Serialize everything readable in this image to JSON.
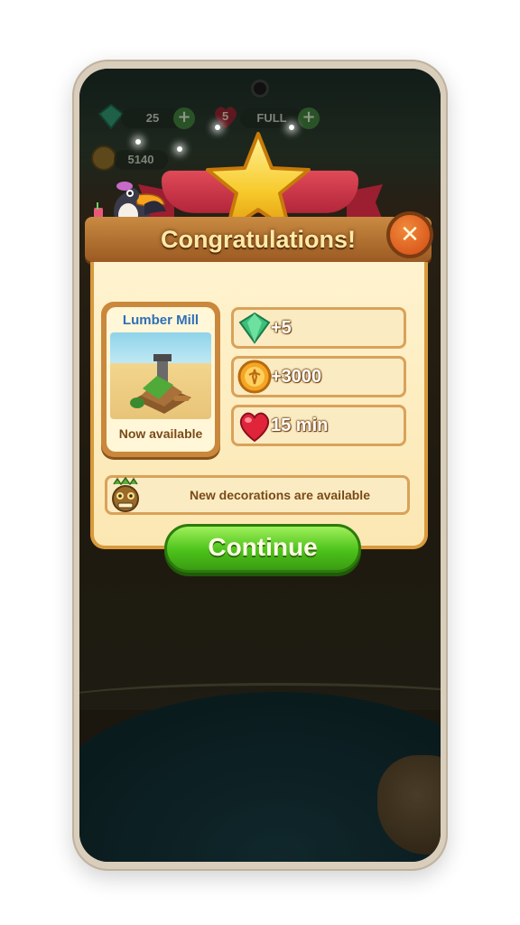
{
  "hud": {
    "gems": "25",
    "lives": "5",
    "lives_status": "FULL",
    "coins": "5140"
  },
  "dialog": {
    "title": "Congratulations!",
    "close_icon": "close-x-icon",
    "unlock_card": {
      "title": "Lumber Mill",
      "footer": "Now available"
    },
    "rewards": [
      {
        "icon": "gem-icon",
        "value": "+5"
      },
      {
        "icon": "coin-icon",
        "value": "+3000"
      },
      {
        "icon": "heart-icon",
        "value": "15 min"
      }
    ],
    "decorations_message": "New decorations are available",
    "continue_label": "Continue"
  },
  "colors": {
    "title_text": "#ffe9a6",
    "continue_green": "#4cc21a",
    "ribbon_red": "#c8303f",
    "close_orange": "#e0621e"
  }
}
